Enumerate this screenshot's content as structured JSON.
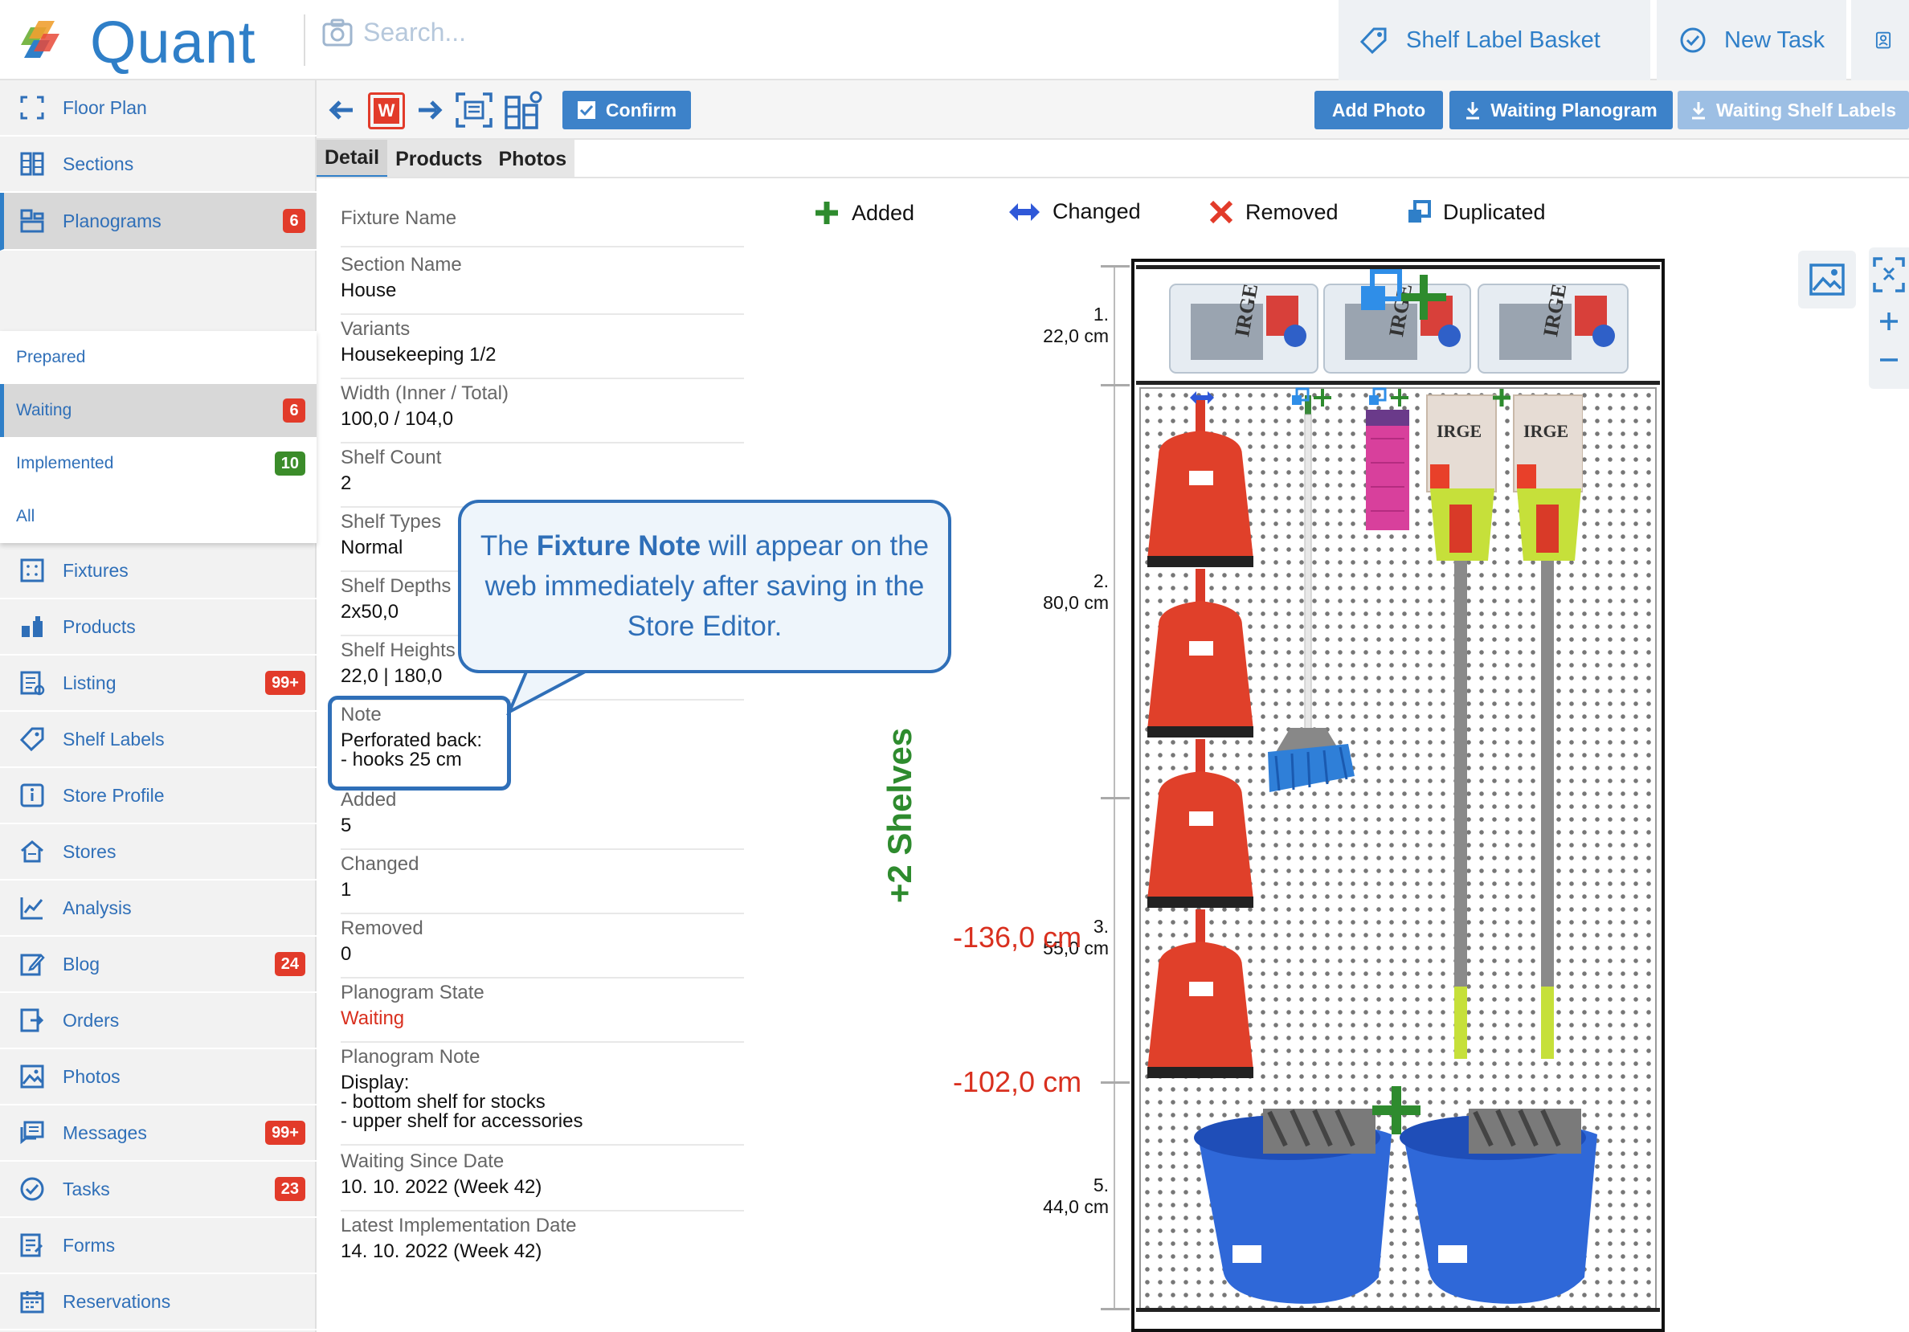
{
  "app": {
    "name": "Quant",
    "search_placeholder": "Search..."
  },
  "top_buttons": {
    "shelf_label_basket": "Shelf Label Basket",
    "new_task": "New Task"
  },
  "sidebar": {
    "items": [
      {
        "label": "Floor Plan"
      },
      {
        "label": "Sections"
      },
      {
        "label": "Planograms",
        "badge": "6"
      },
      {
        "label": "Fixtures"
      },
      {
        "label": "Products"
      },
      {
        "label": "Listing",
        "badge": "99+"
      },
      {
        "label": "Shelf Labels"
      },
      {
        "label": "Store Profile"
      },
      {
        "label": "Stores"
      },
      {
        "label": "Analysis"
      },
      {
        "label": "Blog",
        "badge": "24"
      },
      {
        "label": "Orders"
      },
      {
        "label": "Photos"
      },
      {
        "label": "Messages",
        "badge": "99+"
      },
      {
        "label": "Tasks",
        "badge": "23"
      },
      {
        "label": "Forms"
      },
      {
        "label": "Reservations"
      }
    ],
    "planogram_submenu": [
      {
        "label": "Prepared"
      },
      {
        "label": "Waiting",
        "badge": "6"
      },
      {
        "label": "Implemented",
        "badge": "10"
      },
      {
        "label": "All"
      }
    ]
  },
  "toolbar": {
    "confirm": "Confirm",
    "add_photo": "Add Photo",
    "waiting_planogram": "Waiting Planogram",
    "waiting_shelf_labels": "Waiting Shelf Labels",
    "w_badge": "W"
  },
  "tabs": [
    "Detail",
    "Products",
    "Photos"
  ],
  "detail": [
    {
      "label": "Fixture Name",
      "value": ""
    },
    {
      "label": "Section Name",
      "value": "House"
    },
    {
      "label": "Variants",
      "value": "Housekeeping 1/2"
    },
    {
      "label": "Width (Inner / Total)",
      "value": "100,0 / 104,0"
    },
    {
      "label": "Shelf Count",
      "value": "2"
    },
    {
      "label": "Shelf Types",
      "value": "Normal"
    },
    {
      "label": "Shelf Depths",
      "value": "2x50,0"
    },
    {
      "label": "Shelf Heights",
      "value": "22,0 | 180,0"
    },
    {
      "label": "Note",
      "value": "Perforated back:\n- hooks 25 cm"
    },
    {
      "label": "Added",
      "value": "5"
    },
    {
      "label": "Changed",
      "value": "1"
    },
    {
      "label": "Removed",
      "value": "0"
    },
    {
      "label": "Planogram State",
      "value": "Waiting"
    },
    {
      "label": "Planogram Note",
      "value": "Display:\n- bottom shelf for stocks\n- upper shelf for accessories"
    },
    {
      "label": "Waiting Since Date",
      "value": "10. 10. 2022 (Week 42)"
    },
    {
      "label": "Latest Implementation Date",
      "value": "14. 10. 2022 (Week 42)"
    }
  ],
  "callout": {
    "prefix": "The ",
    "bold": "Fixture Note",
    "suffix": " will appear on the web immediately after saving in the Store Editor."
  },
  "legend": {
    "added": "Added",
    "changed": "Changed",
    "removed": "Removed",
    "duplicated": "Duplicated"
  },
  "planogram": {
    "shelves": [
      {
        "index": "1.",
        "height": "22,0 cm"
      },
      {
        "index": "2.",
        "height": "80,0 cm"
      },
      {
        "index": "3.",
        "height": "55,0 cm"
      },
      {
        "index": "5.",
        "height": "44,0 cm"
      }
    ],
    "red_dims": [
      "-136,0 cm",
      "-102,0 cm"
    ],
    "shelves_change": "+2 Shelves",
    "product_brand": "IRGE"
  },
  "colors": {
    "accent": "#2f7fc8",
    "added": "#2e8b2e",
    "removed": "#d9301f",
    "badge_red": "#e23b2a",
    "badge_green": "#3b8c2a"
  }
}
